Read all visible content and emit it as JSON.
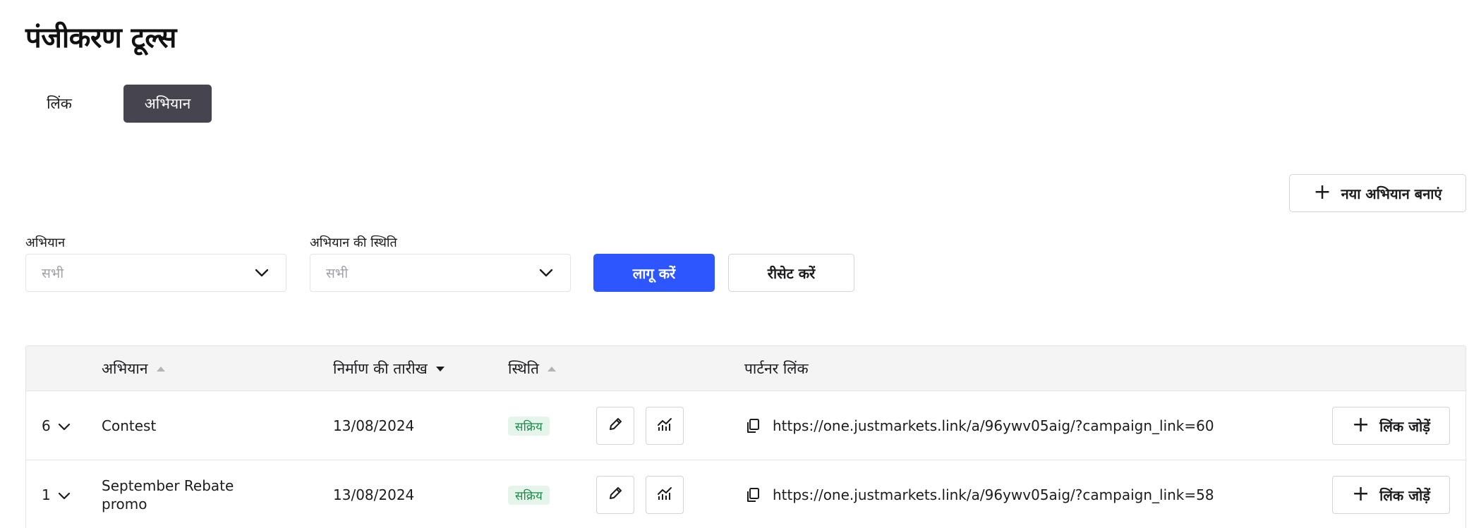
{
  "page": {
    "title": "पंजीकरण टूल्स"
  },
  "tabs": [
    {
      "label": "लिंक",
      "active": false
    },
    {
      "label": "अभियान",
      "active": true
    }
  ],
  "toolbar": {
    "new_campaign_label": "नया अभियान बनाएं"
  },
  "filters": {
    "campaign_label": "अभियान",
    "campaign_value": "सभी",
    "status_label": "अभियान की स्थिति",
    "status_value": "सभी",
    "apply_label": "लागू करें",
    "reset_label": "रीसेट करें"
  },
  "table": {
    "columns": {
      "campaign": "अभियान",
      "created": "निर्माण की तारीख",
      "status": "स्थिति",
      "partner_link": "पार्टनर लिंक"
    },
    "rows": [
      {
        "count": "6",
        "name": "Contest",
        "date": "13/08/2024",
        "status": "सक्रिय",
        "link": "https://one.justmarkets.link/a/96ywv05aig/?campaign_link=60",
        "add_link_label": "लिंक जोड़ें"
      },
      {
        "count": "1",
        "name": "September Rebate promo",
        "date": "13/08/2024",
        "status": "सक्रिय",
        "link": "https://one.justmarkets.link/a/96ywv05aig/?campaign_link=58",
        "add_link_label": "लिंक जोड़ें"
      }
    ]
  },
  "colors": {
    "primary": "#2e56ff",
    "active_tab": "#46454f",
    "status_active_bg": "#e6f5ec",
    "status_active_text": "#1e8a4c"
  }
}
